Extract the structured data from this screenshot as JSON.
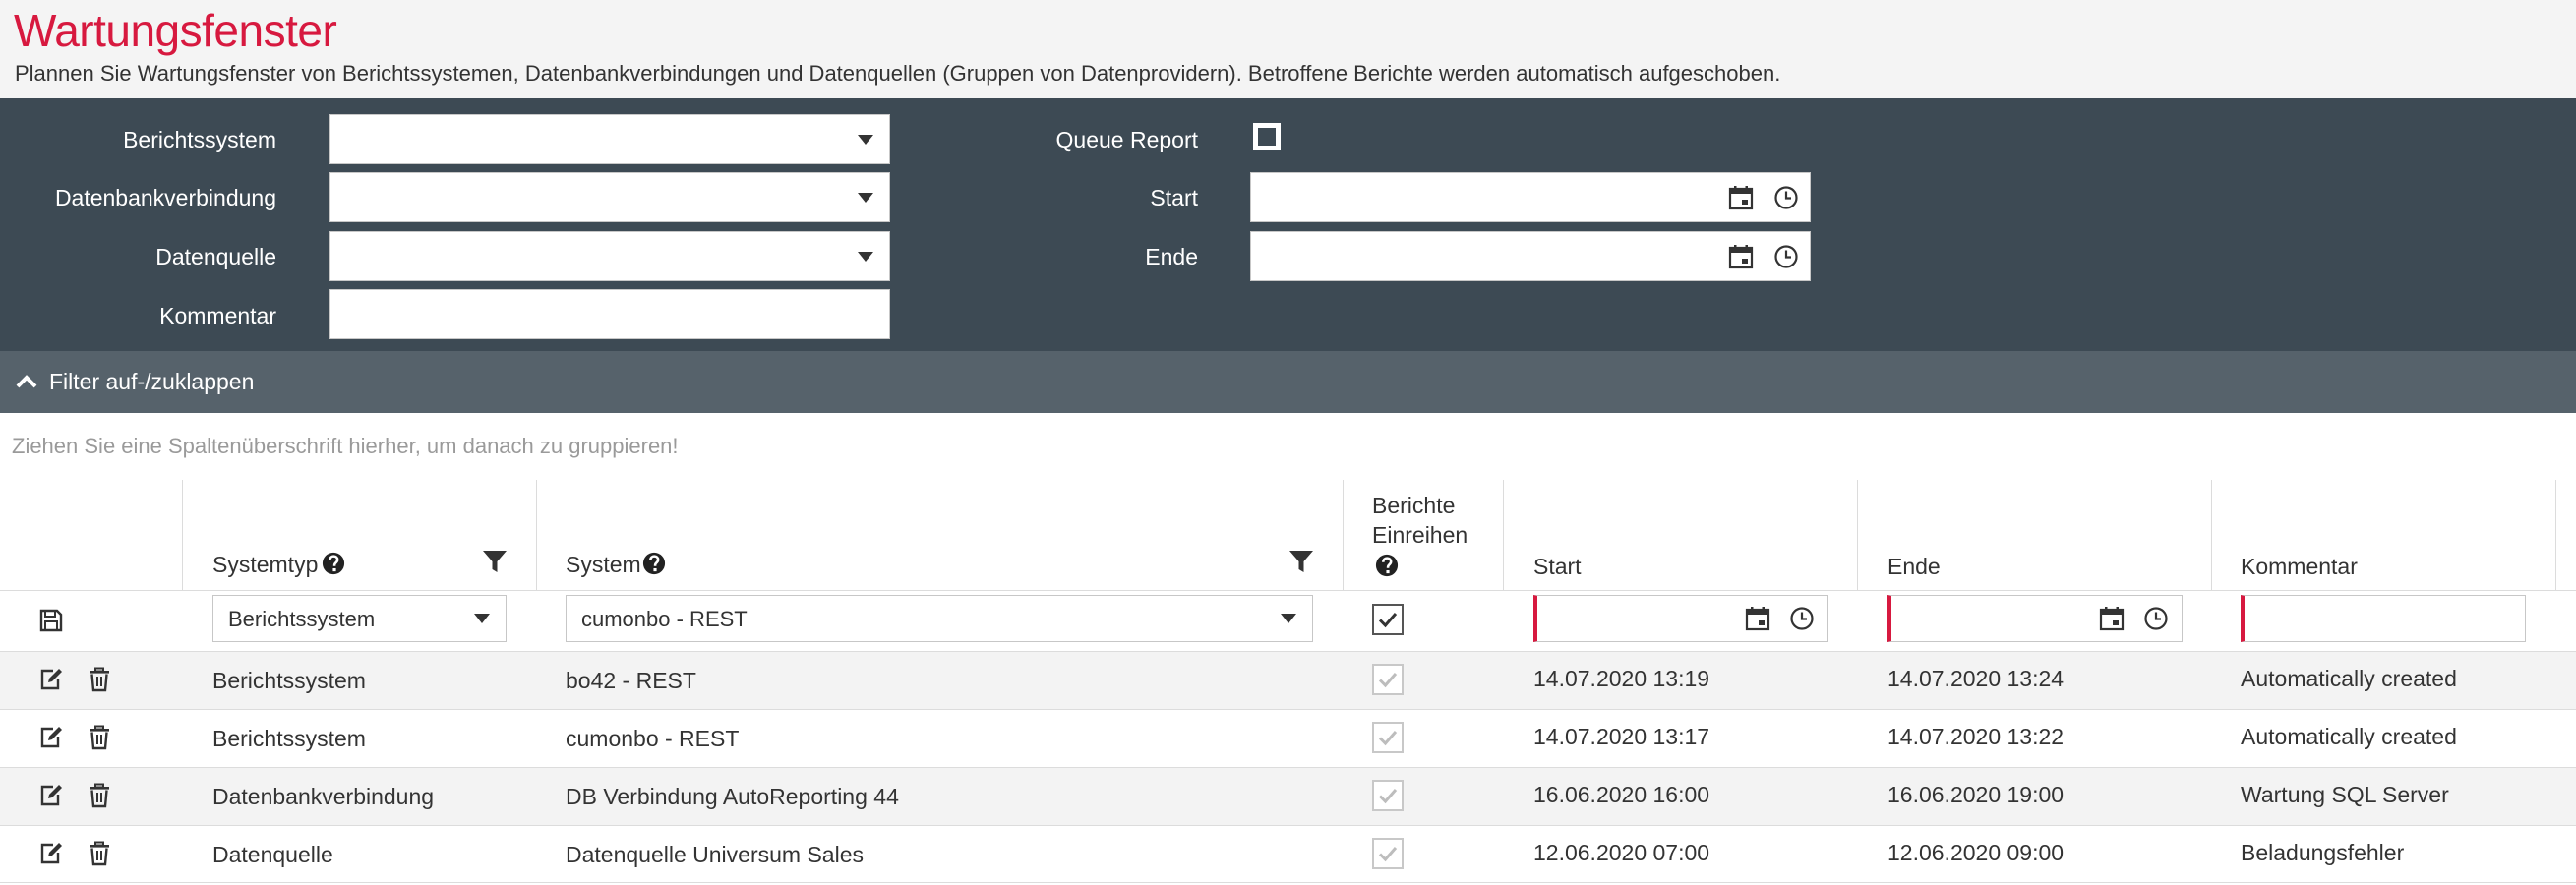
{
  "page": {
    "title": "Wartungsfenster",
    "subtitle": "Plannen Sie Wartungsfenster von Berichtssystemen, Datenbankverbindungen und Datenquellen (Gruppen von Datenprovidern). Betroffene Berichte werden automatisch aufgeschoben."
  },
  "filter": {
    "berichtssystem_label": "Berichtssystem",
    "berichtssystem_value": "",
    "datenbankverbindung_label": "Datenbankverbindung",
    "datenbankverbindung_value": "",
    "datenquelle_label": "Datenquelle",
    "datenquelle_value": "",
    "kommentar_label": "Kommentar",
    "kommentar_value": "",
    "queue_report_label": "Queue Report",
    "queue_report_checked": false,
    "start_label": "Start",
    "start_value": "",
    "ende_label": "Ende",
    "ende_value": "",
    "toggle_label": "Filter auf-/zuklappen"
  },
  "grid": {
    "group_hint": "Ziehen Sie eine Spaltenüberschrift hierher, um danach zu gruppieren!",
    "columns": {
      "systemtyp": "Systemtyp",
      "system": "System",
      "berichte_einreihen_1": "Berichte",
      "berichte_einreihen_2": "Einreihen",
      "start": "Start",
      "ende": "Ende",
      "kommentar": "Kommentar"
    },
    "edit_row": {
      "systemtyp": "Berichtssystem",
      "system": "cumonbo - REST",
      "einreihen": true,
      "start": "",
      "ende": "",
      "kommentar": ""
    },
    "rows": [
      {
        "systemtyp": "Berichtssystem",
        "system": "bo42 - REST",
        "einreihen": true,
        "start": "14.07.2020 13:19",
        "ende": "14.07.2020 13:24",
        "kommentar": "Automatically created"
      },
      {
        "systemtyp": "Berichtssystem",
        "system": "cumonbo - REST",
        "einreihen": true,
        "start": "14.07.2020 13:17",
        "ende": "14.07.2020 13:22",
        "kommentar": "Automatically created"
      },
      {
        "systemtyp": "Datenbankverbindung",
        "system": "DB Verbindung AutoReporting 44",
        "einreihen": true,
        "start": "16.06.2020 16:00",
        "ende": "16.06.2020 19:00",
        "kommentar": "Wartung SQL Server"
      },
      {
        "systemtyp": "Datenquelle",
        "system": "Datenquelle Universum Sales",
        "einreihen": true,
        "start": "12.06.2020 07:00",
        "ende": "12.06.2020 09:00",
        "kommentar": "Beladungsfehler"
      }
    ]
  },
  "colors": {
    "brand": "#d7193f",
    "panel": "#3d4a54",
    "toggle_bar": "#56626b"
  },
  "icons": [
    "calendar-icon",
    "clock-icon",
    "save-icon",
    "edit-icon",
    "trash-icon",
    "filter-icon",
    "help-icon",
    "chevron-up-icon",
    "dropdown-caret-icon",
    "check-icon"
  ]
}
